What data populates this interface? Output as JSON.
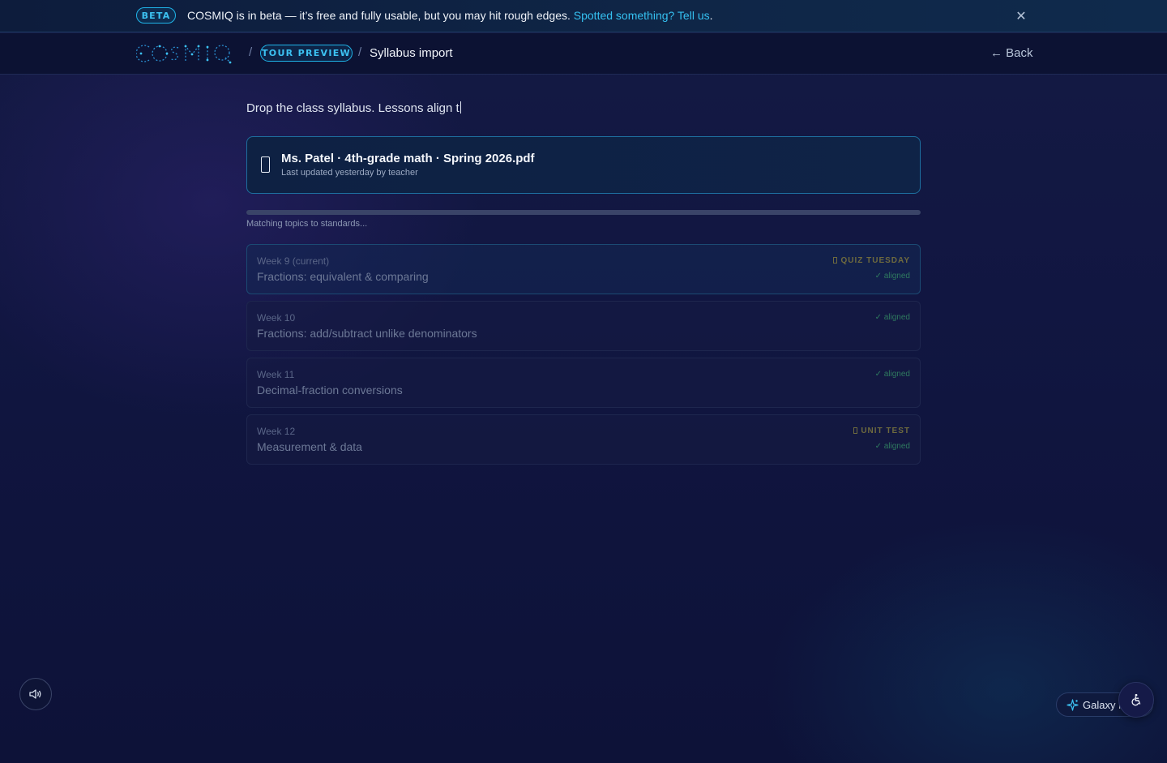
{
  "banner": {
    "badge": "BETA",
    "message": "COSMIQ is in beta — it’s free and fully usable, but you may hit rough edges. ",
    "link": "Spotted something? Tell us",
    "trailing": ".",
    "close_icon": "close-icon"
  },
  "nav": {
    "logo_text": "COSMIQ",
    "separator": "/",
    "tour_badge": "TOUR PREVIEW",
    "current_page": "Syllabus import",
    "back_label": "← Back"
  },
  "main": {
    "intro": "Drop the class syllabus. Lessons align t",
    "file": {
      "icon": "phone-icon",
      "name": "Ms. Patel · 4th-grade math · Spring 2026.pdf",
      "meta": "Last updated yesterday by teacher"
    },
    "progress": {
      "value_percent": 100,
      "label": "Matching topics to standards..."
    },
    "weeks": [
      {
        "label": "Week 9 (current)",
        "title": "Fractions: equivalent & comparing",
        "badge": "QUIZ TUESDAY",
        "status": "✓ aligned"
      },
      {
        "label": "Week 10",
        "title": "Fractions: add/subtract unlike denominators",
        "badge": "",
        "status": "✓ aligned"
      },
      {
        "label": "Week 11",
        "title": "Decimal-fraction conversions",
        "badge": "",
        "status": "✓ aligned"
      },
      {
        "label": "Week 12",
        "title": "Measurement & data",
        "badge": "UNIT TEST",
        "status": "✓ aligned"
      }
    ]
  },
  "controls": {
    "sound_icon": "speaker-icon",
    "galaxy_label": "Galaxy m",
    "galaxy_icon": "sparkle-icon",
    "accessibility_icon": "accessibility-icon"
  },
  "colors": {
    "accent": "#3cc2f2",
    "aligned": "#2f7a5f",
    "badge": "#6e6a3e",
    "background": "#111641"
  }
}
